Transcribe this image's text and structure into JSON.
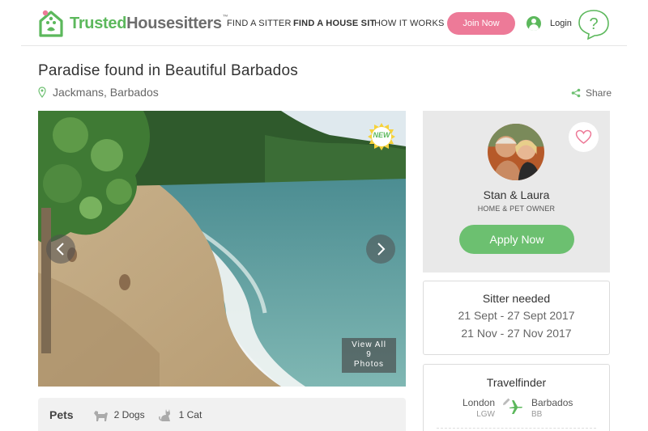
{
  "header": {
    "logo_part1": "Trusted",
    "logo_part2": "Housesitters",
    "logo_tm": "™",
    "nav": [
      {
        "label": "FIND A SITTER"
      },
      {
        "label": "FIND A HOUSE SIT"
      },
      {
        "label": "HOW IT WORKS"
      }
    ],
    "join_label": "Join Now",
    "login_label": "Login",
    "help_label": "?"
  },
  "listing": {
    "title": "Paradise found in Beautiful Barbados",
    "location": "Jackmans, Barbados",
    "share_label": "Share"
  },
  "gallery": {
    "badge": "NEW",
    "view_all_line1": "View All",
    "view_all_count": "9",
    "view_all_line3": "Photos"
  },
  "pets": {
    "label": "Pets",
    "items": [
      {
        "icon": "dog-icon",
        "text": "2 Dogs"
      },
      {
        "icon": "cat-icon",
        "text": "1 Cat"
      }
    ]
  },
  "owner": {
    "name": "Stan & Laura",
    "role": "HOME & PET OWNER",
    "apply_label": "Apply Now"
  },
  "sitter_needed": {
    "title": "Sitter needed",
    "dates": [
      "21 Sept - 27 Sept 2017",
      "21 Nov - 27 Nov 2017"
    ]
  },
  "travelfinder": {
    "title": "Travelfinder",
    "from_city": "London",
    "from_code": "LGW",
    "to_city": "Barbados",
    "to_code": "BB"
  },
  "colors": {
    "brand_green": "#5cb85c",
    "join_pink": "#ed7a98",
    "apply_green": "#6cc070"
  }
}
